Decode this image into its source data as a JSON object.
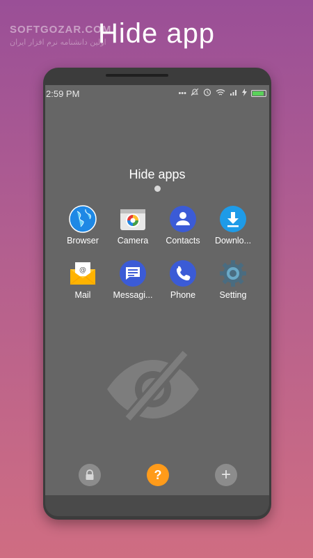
{
  "promo": {
    "title": "Hide app",
    "watermark": "SOFTGOZAR.COM",
    "watermark_sub": "اولین دانشنامه نرم افزار ایران"
  },
  "status_bar": {
    "time": "2:59 PM",
    "icons": [
      "more-dots-icon",
      "mute-icon",
      "alarm-icon",
      "wifi-icon",
      "signal-icon",
      "charging-icon",
      "battery-icon"
    ]
  },
  "screen": {
    "title": "Hide apps",
    "apps": [
      {
        "label": "Browser",
        "icon": "globe-icon",
        "color": "#1e88e5"
      },
      {
        "label": "Camera",
        "icon": "camera-icon",
        "color": "#e0e0e0"
      },
      {
        "label": "Contacts",
        "icon": "contacts-icon",
        "color": "#3b5bd6"
      },
      {
        "label": "Downlo...",
        "icon": "download-icon",
        "color": "#1e9be8"
      },
      {
        "label": "Mail",
        "icon": "mail-icon",
        "color": "#ffc835"
      },
      {
        "label": "Messagi...",
        "icon": "message-icon",
        "color": "#3b5bd6"
      },
      {
        "label": "Phone",
        "icon": "phone-icon",
        "color": "#3b5bd6"
      },
      {
        "label": "Setting",
        "icon": "gear-icon",
        "color": "#4a6c80"
      }
    ]
  },
  "bottom_bar": {
    "help_label": "?",
    "add_label": "+",
    "lock_icon": "lock-icon",
    "accent_color": "#ff9b1a"
  }
}
